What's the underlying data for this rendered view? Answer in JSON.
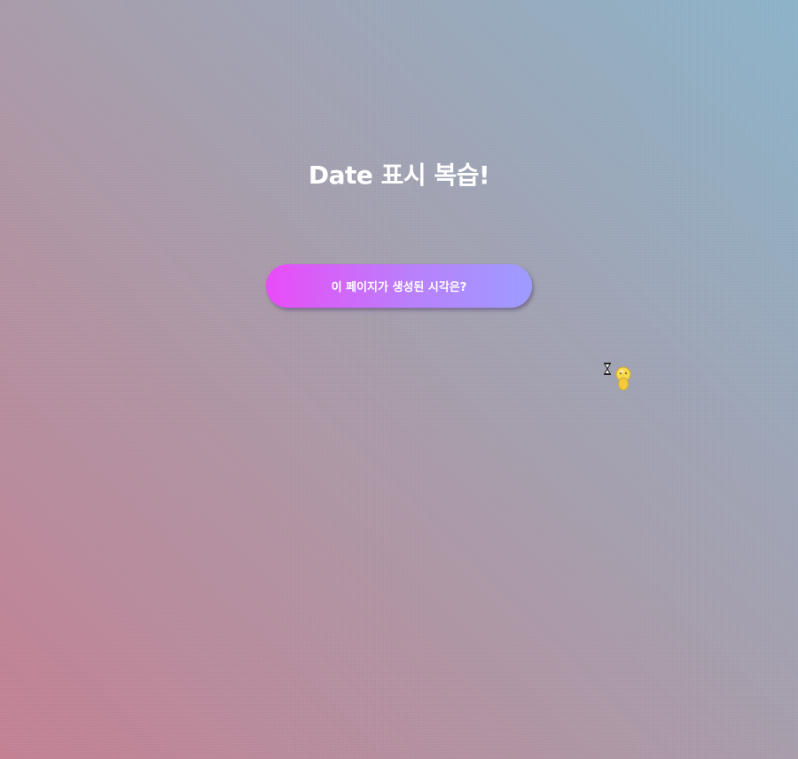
{
  "page": {
    "title": "Date 표시 복습!",
    "button_label": "이 페이지가 생성된 시각은?"
  },
  "colors": {
    "background_start": "#c27f92",
    "background_end": "#8bb2c8",
    "button_start": "#e94cf7",
    "button_end": "#9d9cff",
    "text": "#ffffff"
  },
  "icons": {
    "cursor": "busy-pointer-icon"
  }
}
